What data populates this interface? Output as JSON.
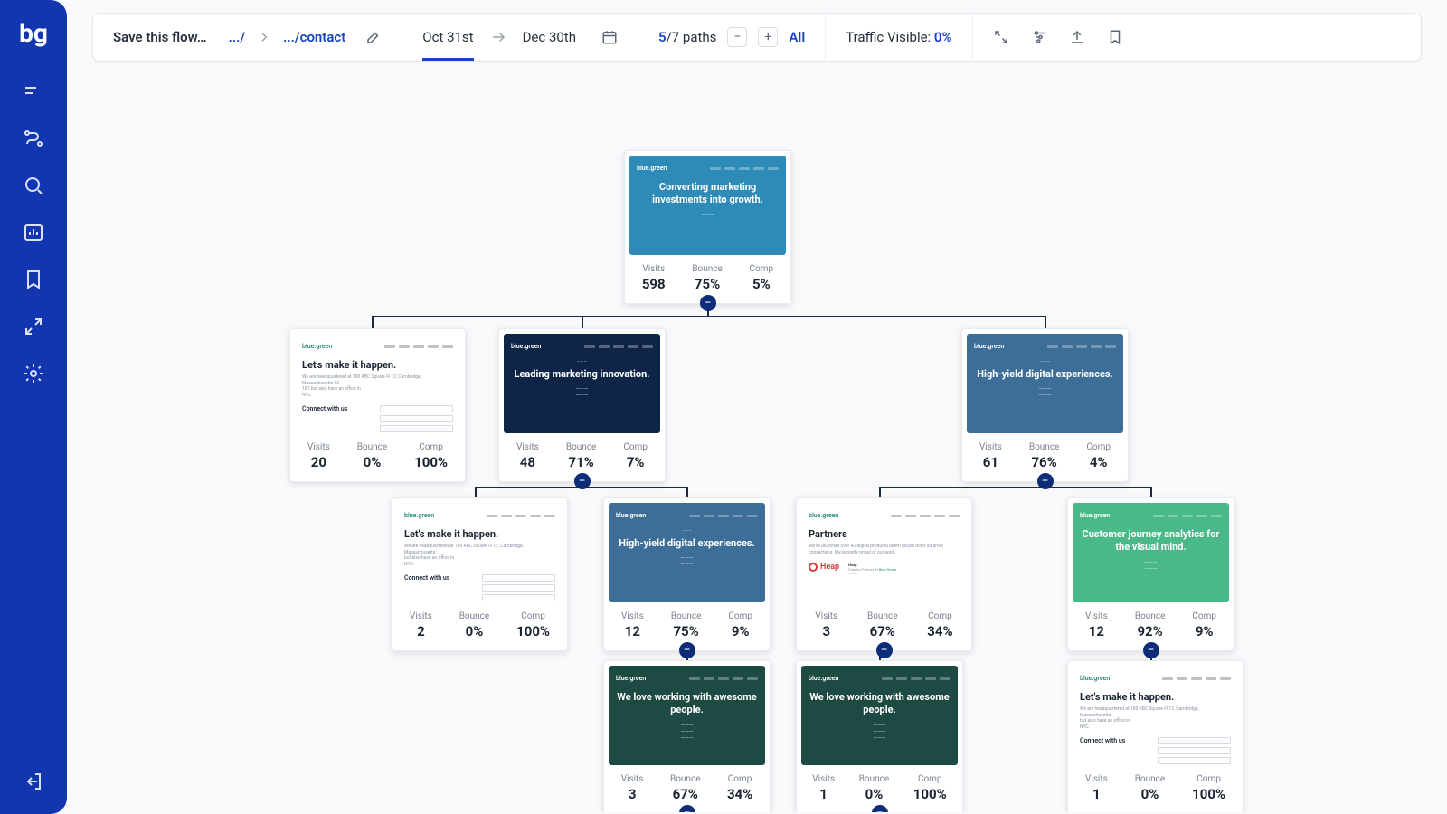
{
  "sidebar": {
    "logo": "bg"
  },
  "toolbar": {
    "save_label": "Save this flow…",
    "bc_root": ".../",
    "bc_leaf": ".../contact",
    "date_start": "Oct 31st",
    "date_end": "Dec 30th",
    "paths_cur": "5",
    "paths_sep": "/7 paths",
    "all_label": "All",
    "traffic_label": "Traffic Visible: ",
    "traffic_value": "0%"
  },
  "nodes": {
    "root": {
      "hero": "Converting marketing investments into growth.",
      "stats": {
        "visits": "598",
        "bounce": "75%",
        "comp": "5%"
      }
    },
    "l1a": {
      "h1": "Let's make it happen.",
      "sec": "Connect with us",
      "stats": {
        "visits": "20",
        "bounce": "0%",
        "comp": "100%"
      }
    },
    "l1b": {
      "hero": "Leading marketing innovation.",
      "stats": {
        "visits": "48",
        "bounce": "71%",
        "comp": "7%"
      }
    },
    "l1c": {
      "hero": "High-yield digital experiences.",
      "stats": {
        "visits": "61",
        "bounce": "76%",
        "comp": "4%"
      }
    },
    "l2a": {
      "h1": "Let's make it happen.",
      "sec": "Connect with us",
      "stats": {
        "visits": "2",
        "bounce": "0%",
        "comp": "100%"
      }
    },
    "l2b": {
      "hero": "High-yield digital experiences.",
      "stats": {
        "visits": "12",
        "bounce": "75%",
        "comp": "9%"
      }
    },
    "l2c": {
      "h1": "Partners",
      "partner": "Heap",
      "stats": {
        "visits": "3",
        "bounce": "67%",
        "comp": "34%"
      }
    },
    "l2d": {
      "hero": "Customer journey analytics for the visual mind.",
      "stats": {
        "visits": "12",
        "bounce": "92%",
        "comp": "9%"
      }
    },
    "l3a": {
      "hero": "We love working with awesome people.",
      "stats": {
        "visits": "3",
        "bounce": "67%",
        "comp": "34%"
      }
    },
    "l3b": {
      "hero": "We love working with awesome people.",
      "stats": {
        "visits": "1",
        "bounce": "0%",
        "comp": "100%"
      }
    },
    "l3c": {
      "h1": "Let's make it happen.",
      "sec": "Connect with us",
      "stats": {
        "visits": "1",
        "bounce": "0%",
        "comp": "100%"
      }
    }
  },
  "labels": {
    "visits": "Visits",
    "bounce": "Bounce",
    "comp": "Comp"
  },
  "thumb_company": "blue.green"
}
